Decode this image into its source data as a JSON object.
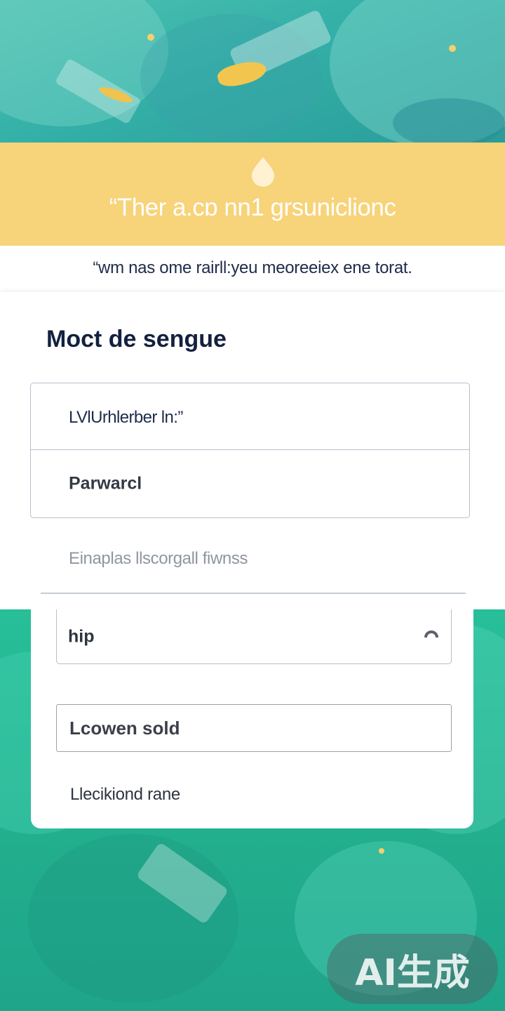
{
  "banner": {
    "tagline": "“Ther  a.cɒ nn1 grsuniclionc",
    "subtagline": "“wm nas ome rairll:yeu meoreeiex ene torat."
  },
  "form": {
    "title": "Moct de sengue",
    "username_field_text": "LVlUrhlerber ln:”",
    "password_field_text": "Parwarcl",
    "hint_text": "Einaplas  llscorgall fiwnss",
    "hip_field_text": "hip",
    "button_label": "Lcowen sold",
    "bottom_link": "Llecikiond rane"
  },
  "icons": {
    "banner_icon": "drop-icon",
    "field_icon": "lock-icon"
  },
  "colors": {
    "banner": "#f7d379",
    "teal": "#2bb894",
    "title_text": "#13213f"
  },
  "watermark": {
    "text": "AI生成"
  }
}
